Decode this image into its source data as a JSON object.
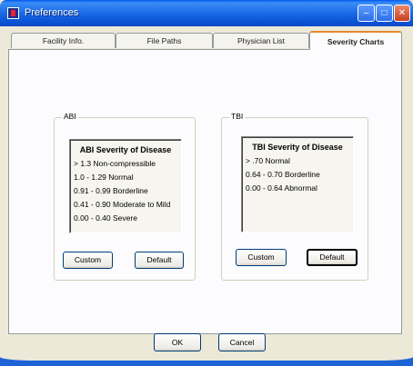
{
  "window": {
    "title": "Preferences"
  },
  "tabs": [
    {
      "label": "Facility Info."
    },
    {
      "label": "File Paths"
    },
    {
      "label": "Physician List"
    },
    {
      "label": "Severity Charts"
    }
  ],
  "abi": {
    "group_label": "ABI",
    "chart_title": "ABI Severity of Disease",
    "lines": [
      "> 1.3 Non-compressible",
      "1.0 - 1.29 Normal",
      "0.91 - 0.99 Borderline",
      "0.41 - 0.90 Moderate to Mild",
      "0.00 - 0.40  Severe"
    ],
    "custom_label": "Custom",
    "default_label": "Default"
  },
  "tbi": {
    "group_label": "TBI",
    "chart_title": "TBI Severity of Disease",
    "lines": [
      "> .70 Normal",
      "0.64 - 0.70 Borderline",
      "0.00 - 0.64 Abnormal"
    ],
    "custom_label": "Custom",
    "default_label": "Default"
  },
  "footer": {
    "ok_label": "OK",
    "cancel_label": "Cancel"
  }
}
